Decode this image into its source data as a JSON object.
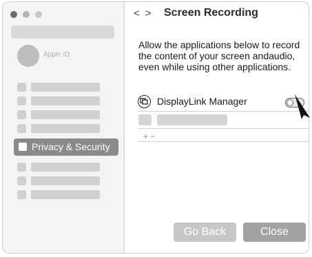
{
  "window": {
    "traffic_lights": [
      "close",
      "minimize",
      "zoom"
    ]
  },
  "sidebar": {
    "account_label": "Apple ID",
    "selected_item": {
      "label": "Privacy & Security",
      "icon": "checkbox-icon"
    }
  },
  "header": {
    "back_glyph": "<",
    "forward_glyph": ">",
    "title": "Screen Recording"
  },
  "content": {
    "description": "Allow the applications below to record the content of your screen andaudio, even while using other applications.",
    "apps": [
      {
        "name": "DisplayLink Manager",
        "icon": "displaylink-icon",
        "enabled": false
      }
    ],
    "list_controls": {
      "add": "+",
      "remove": "−"
    }
  },
  "buttons": {
    "go_back": "Go Back",
    "close": "Close"
  },
  "colors": {
    "sidebar_bg": "#f4f4f4",
    "selected_bg": "#8a8a8a",
    "button_bg": "#a3a3a3",
    "button_disabled_bg": "#c7c7c7"
  }
}
